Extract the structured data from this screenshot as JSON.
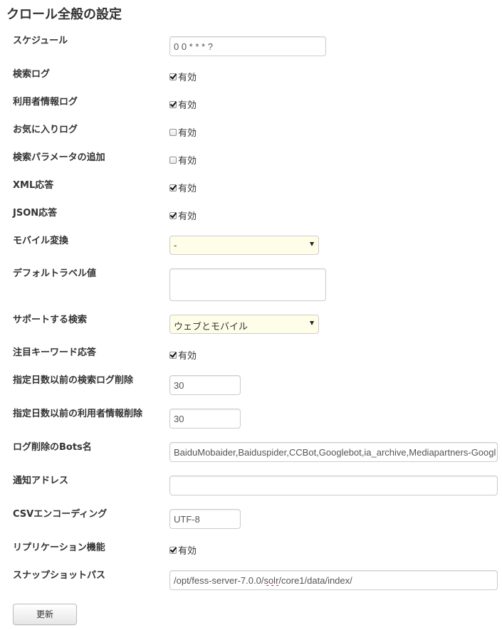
{
  "page": {
    "title": "クロール全般の設定"
  },
  "fields": {
    "schedule": {
      "label": "スケジュール",
      "value": "0 0 * * * ?"
    },
    "search_log": {
      "label": "検索ログ",
      "checked": true,
      "option": "有効"
    },
    "user_info_log": {
      "label": "利用者情報ログ",
      "checked": true,
      "option": "有効"
    },
    "favorite_log": {
      "label": "お気に入りログ",
      "checked": false,
      "option": "有効"
    },
    "search_params": {
      "label": "検索パラメータの追加",
      "checked": false,
      "option": "有効"
    },
    "xml_response": {
      "label": "XML応答",
      "checked": true,
      "option": "有効"
    },
    "json_response": {
      "label": "JSON応答",
      "checked": true,
      "option": "有効"
    },
    "mobile_transform": {
      "label": "モバイル変換",
      "value": "-"
    },
    "default_label": {
      "label": "デフォルトラベル値",
      "value": ""
    },
    "supported_search": {
      "label": "サポートする検索",
      "value": "ウェブとモバイル"
    },
    "hot_keyword": {
      "label": "注目キーワード応答",
      "checked": true,
      "option": "有効"
    },
    "purge_search_log": {
      "label": "指定日数以前の検索ログ削除",
      "value": "30"
    },
    "purge_user_info": {
      "label": "指定日数以前の利用者情報削除",
      "value": "30"
    },
    "bots_name": {
      "label": "ログ削除のBots名",
      "value": "BaiduMobaider,Baiduspider,CCBot,Googlebot,ia_archive,Mediapartners-Google"
    },
    "notify_address": {
      "label": "通知アドレス",
      "value": ""
    },
    "csv_encoding": {
      "label": "CSVエンコーディング",
      "value": "UTF-8"
    },
    "replication": {
      "label": "リプリケーション機能",
      "checked": true,
      "option": "有効"
    },
    "snapshot_path": {
      "label": "スナップショットパス",
      "value_prefix": "/opt/fess-server-7.0.0/",
      "value_underlined": "solr",
      "value_suffix": "/core1/data/index/"
    }
  },
  "actions": {
    "update_label": "更新"
  }
}
